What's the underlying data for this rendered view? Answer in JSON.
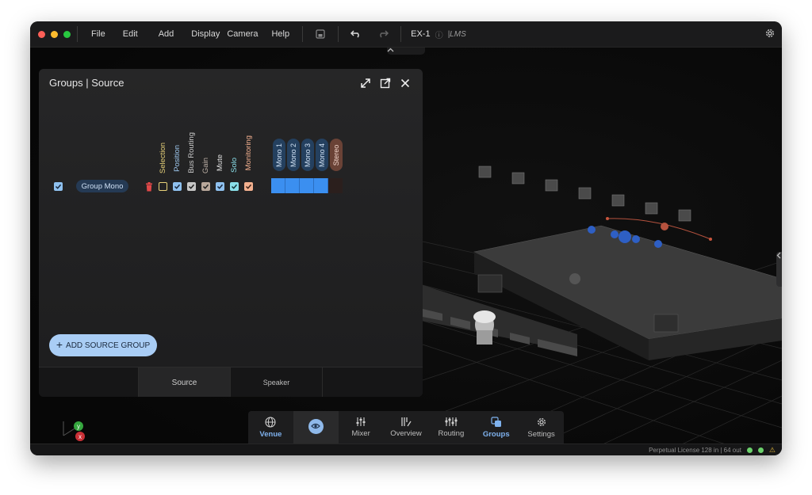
{
  "menu": [
    "File",
    "Edit",
    "Add",
    "Display",
    "Camera",
    "Help"
  ],
  "project": {
    "name": "EX-1",
    "info_glyph": "ⓘ",
    "suffix": "|LMS"
  },
  "panel": {
    "title": "Groups | Source",
    "columns": [
      "Selection",
      "Position",
      "Bus Routing",
      "Gain",
      "Mute",
      "Solo",
      "Monitoring"
    ],
    "channels": [
      "Mono 1",
      "Mono 2",
      "Mono 3",
      "Mono 4",
      "Stereo"
    ],
    "group": {
      "name": "Group Mono",
      "enabled": true
    },
    "add_button": "ADD SOURCE GROUP",
    "add_glyph": "+",
    "tabs": [
      {
        "label": ""
      },
      {
        "label": "Source"
      },
      {
        "label": "Speaker"
      },
      {
        "label": ""
      }
    ],
    "active_tab": "Source"
  },
  "toolbar": [
    {
      "label": "Venue",
      "icon": "globe-icon",
      "active": true
    },
    {
      "label": "",
      "icon": "eye-icon",
      "active": false
    },
    {
      "label": "Mixer",
      "icon": "mixer-icon",
      "active": false
    },
    {
      "label": "Overview",
      "icon": "overview-icon",
      "active": false
    },
    {
      "label": "Routing",
      "icon": "routing-icon",
      "active": false
    },
    {
      "label": "Groups",
      "icon": "groups-icon",
      "active": true
    },
    {
      "label": "Settings",
      "icon": "gear-icon",
      "active": false
    }
  ],
  "status": {
    "license": "Perpetual License 128 in | 64 out",
    "warning_glyph": "⚠"
  },
  "axis": {
    "y": "y",
    "x": "x"
  },
  "colors": {
    "accent": "#3b8ff0",
    "stereo": "#5a3730",
    "selection": "#e9d37a",
    "position": "#8fc1ef",
    "bus": "#c7c7c7",
    "gain": "#b9a89b",
    "mute": "#8fc1ef",
    "solo": "#8ae0ea",
    "monitoring": "#f3b08f"
  }
}
